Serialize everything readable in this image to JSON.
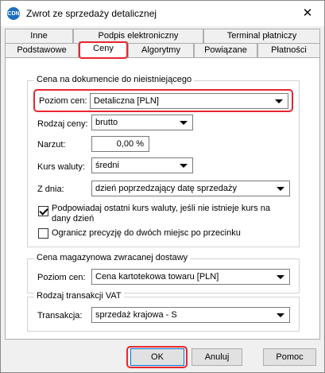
{
  "window": {
    "title": "Zwrot ze sprzedaży detalicznej",
    "icon_name": "app-logo-icon",
    "icon_text": "CDN",
    "close_symbol": "✕"
  },
  "tabs": {
    "top_row": [
      "Inne",
      "Podpis elektroniczny",
      "Terminal płatniczy"
    ],
    "bottom_row": [
      "Podstawowe",
      "Ceny",
      "Algorytmy",
      "Powiązane",
      "Płatności"
    ],
    "active": "Ceny"
  },
  "price_group": {
    "title": "Cena na dokumencie do nieistniejącego",
    "price_level_label": "Poziom cen:",
    "price_level_value": "Detaliczna [PLN]",
    "price_type_label": "Rodzaj ceny:",
    "price_type_value": "brutto",
    "markup_label": "Narzut:",
    "markup_value": "0,00 %",
    "rate_label": "Kurs waluty:",
    "rate_value": "średni",
    "date_label": "Z dnia:",
    "date_value": "dzień poprzedzający datę sprzedaży",
    "suggest_rate_text": "Podpowiadaj ostatni kurs waluty, jeśli nie istnieje kurs na dany dzień",
    "suggest_rate_line1": "Podpowiadaj ostatni kurs waluty, jeśli nie istnieje kurs na",
    "suggest_rate_line2": "dany dzień",
    "suggest_rate_checked": true,
    "limit_precision_text": "Ogranicz precyzję do dwóch miejsc po przecinku",
    "limit_precision_checked": false
  },
  "warehouse_group": {
    "title": "Cena magazynowa zwracanej dostawy",
    "price_level_label": "Poziom cen:",
    "price_level_value": "Cena kartotekowa towaru [PLN]"
  },
  "vat_group": {
    "title": "Rodzaj transakcji VAT",
    "transaction_label": "Transakcja:",
    "transaction_value": "sprzedaż krajowa - S"
  },
  "buttons": {
    "ok": "OK",
    "cancel": "Anuluj",
    "help": "Pomoc"
  },
  "colors": {
    "highlight": "#e8262d",
    "default_button_border": "#0078d7"
  }
}
